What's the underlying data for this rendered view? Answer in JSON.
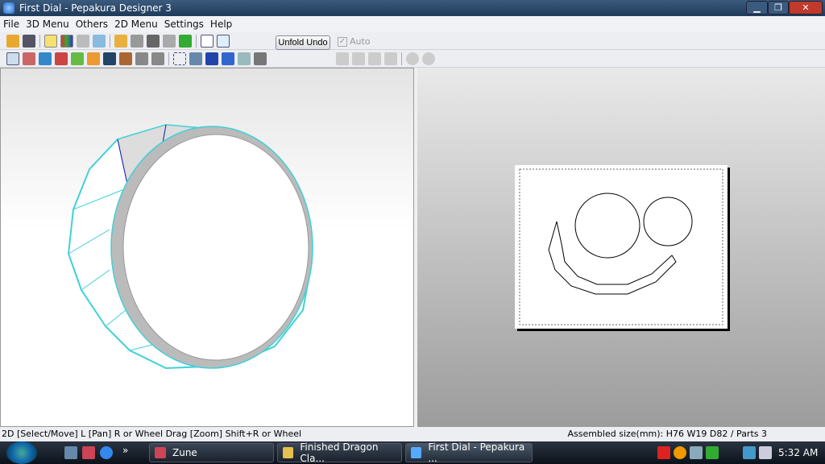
{
  "window": {
    "title": "First Dial - Pepakura Designer 3"
  },
  "menu": [
    "File",
    "3D Menu",
    "Others",
    "2D Menu",
    "Settings",
    "Help"
  ],
  "toolbar": {
    "unfold_undo": "Unfold Undo",
    "auto_label": "Auto",
    "auto_check": "✓"
  },
  "status": {
    "hint": "2D [Select/Move] L [Pan] R or Wheel Drag [Zoom] Shift+R or Wheel",
    "info": "Assembled size(mm): H76 W19 D82 / Parts 3"
  },
  "taskbar": {
    "items": [
      "Zune",
      "Finished Dragon Cla...",
      "First Dial - Pepakura ..."
    ],
    "clock": "5:32 AM",
    "more": "»"
  },
  "colors": {
    "edge": "#40d0d8",
    "fold": "#1a1a9a"
  }
}
